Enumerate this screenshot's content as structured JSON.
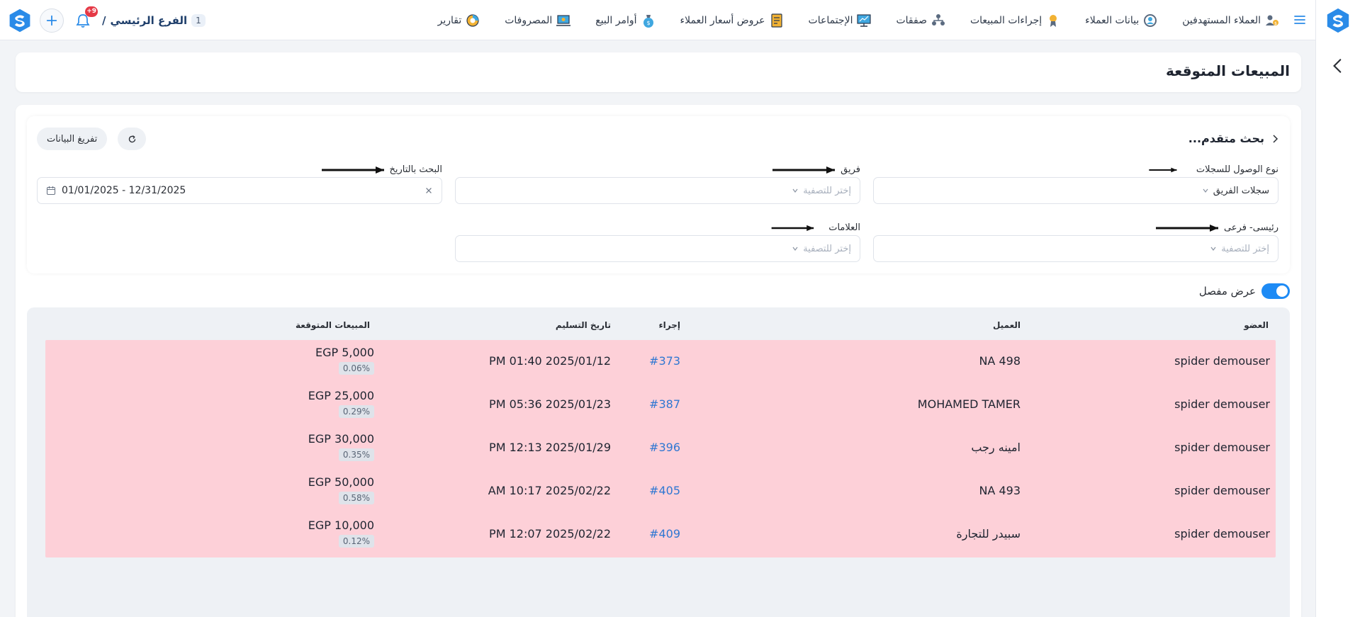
{
  "topbar": {
    "nav": [
      {
        "label": "العملاء المستهدفين",
        "icon": "target-customers-icon"
      },
      {
        "label": "بيانات العملاء",
        "icon": "customer-data-icon"
      },
      {
        "label": "إجراءات المبيعات",
        "icon": "sales-actions-icon"
      },
      {
        "label": "صفقات",
        "icon": "deals-icon"
      },
      {
        "label": "الإجتماعات",
        "icon": "meetings-icon"
      },
      {
        "label": "عروض أسعار العملاء",
        "icon": "quotes-icon"
      },
      {
        "label": "أوامر البيع",
        "icon": "sales-orders-icon"
      },
      {
        "label": "المصروفات",
        "icon": "expenses-icon"
      },
      {
        "label": "تقارير",
        "icon": "reports-icon"
      }
    ],
    "branch": {
      "number": "1",
      "name": "الفرع الرئيسي",
      "separator": "/"
    },
    "notifications_count": "+9"
  },
  "page": {
    "title": "المبيعات المتوقعة"
  },
  "filters": {
    "title": "بحث متقدم...",
    "clear_label": "تفريغ البيانات",
    "access_type": {
      "label": "نوع الوصول للسجلات",
      "value": "سجلات الفريق"
    },
    "team": {
      "label": "فريق",
      "placeholder": "إختر للتصفية"
    },
    "date_search": {
      "label": "البحث بالتاريخ",
      "value": "01/01/2025 - 12/31/2025"
    },
    "main_sub": {
      "label": "رئيسى- فرعى",
      "placeholder": "إختر للتصفية"
    },
    "tags": {
      "label": "العلامات",
      "placeholder": "إختر للتصفية"
    }
  },
  "view": {
    "detailed_label": "عرض مفصل"
  },
  "table": {
    "headers": {
      "member": "العضو",
      "client": "العميل",
      "action": "إجراء",
      "delivery_date": "تاريخ التسليم",
      "expected_sales": "المبيعات المتوقعة"
    },
    "rows": [
      {
        "member": "spider demouser",
        "client": "NA 498",
        "action": "#373",
        "date": "PM 01:40 2025/01/12",
        "amount": "EGP 5,000",
        "pct": "0.06%"
      },
      {
        "member": "spider demouser",
        "client": "MOHAMED TAMER",
        "action": "#387",
        "date": "PM 05:36 2025/01/23",
        "amount": "EGP 25,000",
        "pct": "0.29%"
      },
      {
        "member": "spider demouser",
        "client": "امينه رجب",
        "action": "#396",
        "date": "PM 12:13 2025/01/29",
        "amount": "EGP 30,000",
        "pct": "0.35%"
      },
      {
        "member": "spider demouser",
        "client": "NA 493",
        "action": "#405",
        "date": "AM 10:17 2025/02/22",
        "amount": "EGP 50,000",
        "pct": "0.58%"
      },
      {
        "member": "spider demouser",
        "client": "سبيدر للتجارة",
        "action": "#409",
        "date": "PM 12:07 2025/02/22",
        "amount": "EGP 10,000",
        "pct": "0.12%"
      }
    ]
  },
  "colors": {
    "accent": "#1e8bf5",
    "row_bg": "#fdd0d8",
    "link": "#2f77d2"
  }
}
